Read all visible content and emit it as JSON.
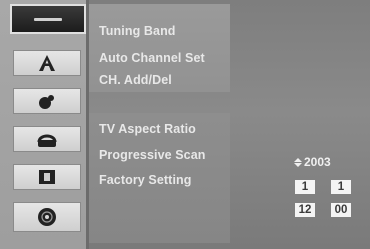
{
  "sidebar": {
    "items": [
      {
        "icon": "menu-bar-icon",
        "active": true
      },
      {
        "icon": "language-a-icon",
        "active": false
      },
      {
        "icon": "display-shapes-icon",
        "active": false
      },
      {
        "icon": "audio-headphones-icon",
        "active": false
      },
      {
        "icon": "record-film-icon",
        "active": false
      },
      {
        "icon": "disc-icon",
        "active": false
      }
    ]
  },
  "menu": {
    "items": [
      "Tuning Band",
      "Auto Channel Set",
      "CH. Add/Del",
      "TV Aspect Ratio",
      "Progressive Scan",
      "Factory Setting"
    ]
  },
  "clock": {
    "year": "2003",
    "month": "1",
    "day": "1",
    "hour": "12",
    "minute": "00"
  }
}
